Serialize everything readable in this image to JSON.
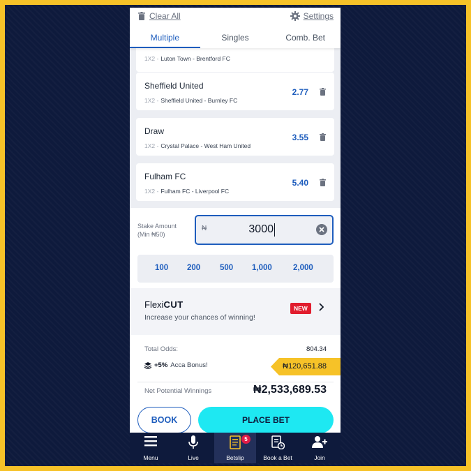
{
  "header": {
    "clear_all": "Clear All",
    "settings": "Settings",
    "tabs": [
      {
        "label": "Multiple",
        "active": true
      },
      {
        "label": "Singles",
        "active": false
      },
      {
        "label": "Comb. Bet",
        "active": false
      }
    ]
  },
  "selections": [
    {
      "team": "",
      "market": "1X2 -",
      "match": "Luton Town - Brentford FC",
      "odd": ""
    },
    {
      "team": "Sheffield United",
      "market": "1X2 -",
      "match": "Sheffield United - Burnley FC",
      "odd": "2.77"
    },
    {
      "team": "Draw",
      "market": "1X2 -",
      "match": "Crystal Palace - West Ham United",
      "odd": "3.55"
    },
    {
      "team": "Fulham FC",
      "market": "1X2 -",
      "match": "Fulham FC - Liverpool FC",
      "odd": "5.40"
    }
  ],
  "stake": {
    "label_line1": "Stake Amount",
    "label_line2": "(Min ₦50)",
    "currency": "₦",
    "value": "3000",
    "quick_amounts": [
      "100",
      "200",
      "500",
      "1,000",
      "2,000"
    ]
  },
  "flexicut": {
    "logo_regular": "Flexi",
    "logo_bold": "CUT",
    "subtitle": "Increase your chances of winning!",
    "badge": "NEW"
  },
  "totals": {
    "total_odds_label": "Total Odds:",
    "total_odds_value": "804.34",
    "bonus_percent": "+5%",
    "bonus_label": "Acca Bonus!",
    "bonus_value": "₦120,651.88",
    "npw_label": "Net Potential Winnings",
    "npw_value": "₦2,533,689.53"
  },
  "buttons": {
    "book": "BOOK",
    "place_bet": "PLACE BET"
  },
  "nav": {
    "items": [
      {
        "label": "Menu",
        "icon": "menu-icon"
      },
      {
        "label": "Live",
        "icon": "microphone-icon"
      },
      {
        "label": "Betslip",
        "icon": "betslip-icon",
        "badge": "5",
        "active": true
      },
      {
        "label": "Book a Bet",
        "icon": "book-a-bet-icon"
      },
      {
        "label": "Join",
        "icon": "add-user-icon"
      }
    ]
  },
  "colors": {
    "accent": "#1e5dbd",
    "place_bet": "#1ee8f2",
    "bonus_tag": "#f6c228",
    "nav_bg": "#0e1a3c",
    "new_badge": "#e11d2e"
  }
}
